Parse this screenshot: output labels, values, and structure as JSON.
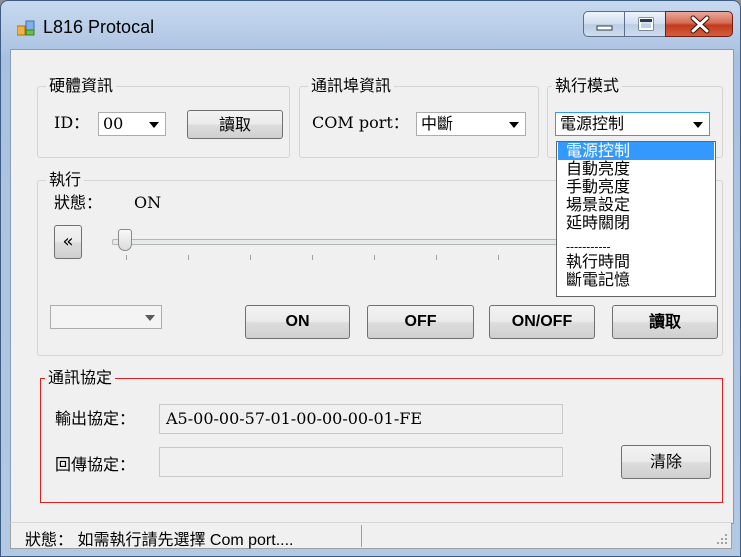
{
  "window": {
    "title": "L816 Protocal"
  },
  "hardware_group": {
    "legend": "硬體資訊",
    "id_label": "ID：",
    "id_value": "00",
    "read_button": "讀取"
  },
  "comm_port_group": {
    "legend": "通訊埠資訊",
    "port_label": "COM port：",
    "port_value": "中斷"
  },
  "mode_group": {
    "legend": "執行模式",
    "selected": "電源控制",
    "options": [
      "電源控制",
      "自動亮度",
      "手動亮度",
      "場景設定",
      "延時關閉",
      "-----------",
      "執行時間",
      "斷電記憶"
    ]
  },
  "execute_group": {
    "legend": "執行",
    "state_label": "狀態：",
    "state_value": "ON",
    "slider_left_button": "«",
    "slider_level": 0,
    "left_combo_value": "",
    "buttons": {
      "on": "ON",
      "off": "OFF",
      "onoff": "ON/OFF",
      "read": "讀取"
    }
  },
  "protocol_group": {
    "legend": "通訊協定",
    "output_label": "輸出協定：",
    "output_value": "A5-00-00-57-01-00-00-00-01-FE",
    "reply_label": "回傳協定：",
    "reply_value": "",
    "clear_button": "清除"
  },
  "status_bar": {
    "text": "狀態：  如需執行請先選擇 Com port...."
  },
  "colors": {
    "protocol_border": "#e02020",
    "selection": "#3399ff",
    "close_button": "#c23a1f"
  }
}
